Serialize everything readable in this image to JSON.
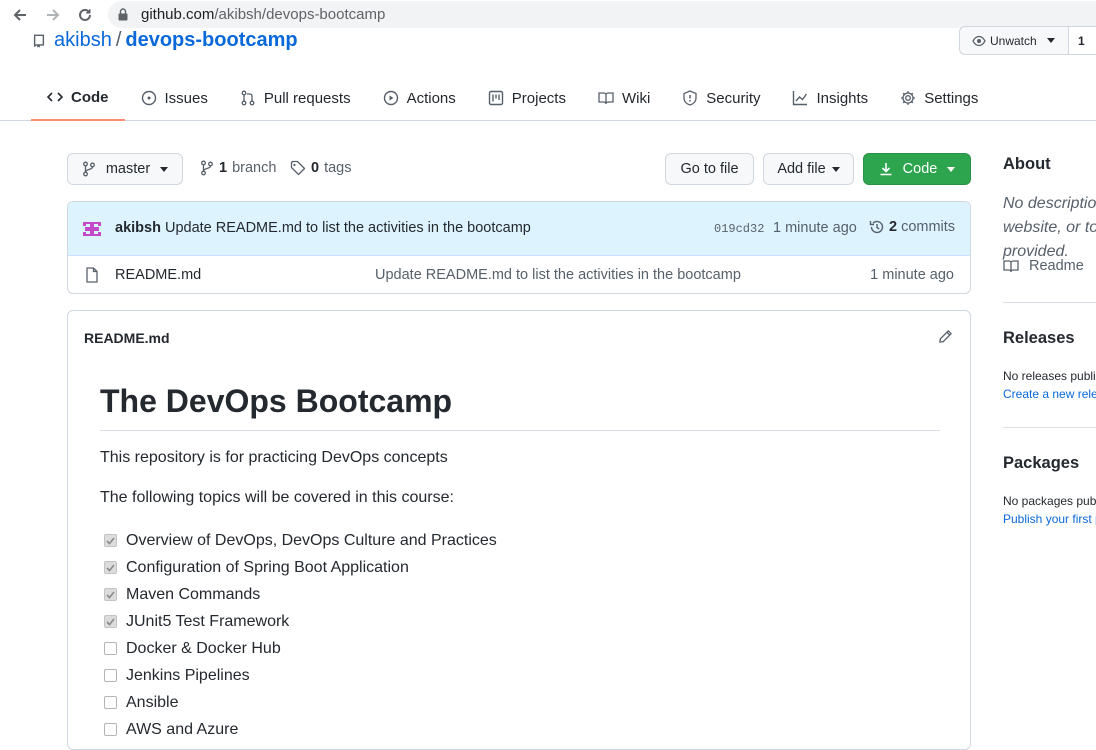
{
  "browser": {
    "url_host": "github.com",
    "url_path": "/akibsh/devops-bootcamp"
  },
  "repo": {
    "owner": "akibsh",
    "separator": "/",
    "name": "devops-bootcamp",
    "watch_label": "Unwatch",
    "watch_count": "1"
  },
  "tabs": [
    {
      "label": "Code",
      "icon": "code-icon",
      "selected": true
    },
    {
      "label": "Issues",
      "icon": "issue-icon"
    },
    {
      "label": "Pull requests",
      "icon": "pull-request-icon"
    },
    {
      "label": "Actions",
      "icon": "play-icon"
    },
    {
      "label": "Projects",
      "icon": "project-icon"
    },
    {
      "label": "Wiki",
      "icon": "book-icon"
    },
    {
      "label": "Security",
      "icon": "shield-icon"
    },
    {
      "label": "Insights",
      "icon": "graph-icon"
    },
    {
      "label": "Settings",
      "icon": "gear-icon"
    }
  ],
  "toolbar": {
    "branch": "master",
    "branch_count": "1",
    "branch_word": "branch",
    "tag_count": "0",
    "tag_word": "tags",
    "go_to_file": "Go to file",
    "add_file": "Add file",
    "code": "Code"
  },
  "commit": {
    "author": "akibsh",
    "message": "Update README.md to list the activities in the bootcamp",
    "sha": "019cd32",
    "time": "1 minute ago",
    "count": "2",
    "count_word": "commits"
  },
  "files": [
    {
      "name": "README.md",
      "message": "Update README.md to list the activities in the bootcamp",
      "time": "1 minute ago"
    }
  ],
  "readme": {
    "file_title": "README.md",
    "heading": "The DevOps Bootcamp",
    "intro": "This repository is for practicing DevOps concepts",
    "topics_intro": "The following topics will be covered in this course:",
    "tasks": [
      {
        "label": "Overview of DevOps, DevOps Culture and Practices",
        "checked": true
      },
      {
        "label": "Configuration of Spring Boot Application",
        "checked": true
      },
      {
        "label": "Maven Commands",
        "checked": true
      },
      {
        "label": "JUnit5 Test Framework",
        "checked": true
      },
      {
        "label": "Docker & Docker Hub",
        "checked": false
      },
      {
        "label": "Jenkins Pipelines",
        "checked": false
      },
      {
        "label": "Ansible",
        "checked": false
      },
      {
        "label": "AWS and Azure",
        "checked": false
      }
    ]
  },
  "sidebar": {
    "about_title": "About",
    "description": "No description, website, or topics provided.",
    "readme_label": "Readme",
    "releases_title": "Releases",
    "releases_text": "No releases published",
    "releases_link": "Create a new release",
    "packages_title": "Packages",
    "packages_text": "No packages published",
    "packages_link": "Publish your first package"
  },
  "colors": {
    "link": "#0969da",
    "primary_button": "#2da44e",
    "selected_tab_underline": "#fd8c73",
    "commit_bar": "#ddf4ff"
  }
}
